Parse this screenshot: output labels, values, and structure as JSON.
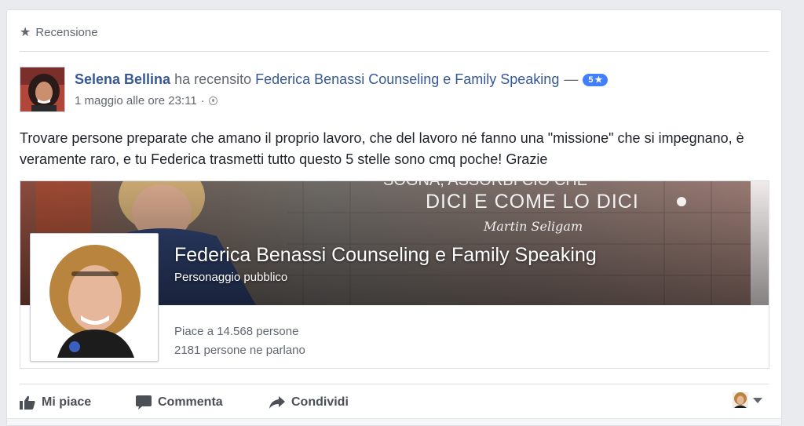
{
  "header": {
    "label": "Recensione",
    "icon": "star-icon"
  },
  "post": {
    "author": "Selena Bellina",
    "verb": "ha recensito",
    "page": "Federica Benassi Counseling e Family Speaking",
    "dash": "—",
    "rating": "5",
    "rating_star": "★",
    "timestamp": "1 maggio alle ore 23:11",
    "separator": "·",
    "text": "Trovare persone preparate che amano il proprio lavoro, che del lavoro né fanno una \"missione\" che si impegnano, è veramente raro, e tu Federica trasmetti tutto questo 5 stelle sono cmq poche! Grazie"
  },
  "attachment": {
    "cover_quote_top": "SOGNA, ASSORBI CIÒ CHE",
    "cover_quote": "DICI E COME LO DICI",
    "cover_signature": "Martin Seligam",
    "page_name": "Federica Benassi Counseling e Family Speaking",
    "category": "Personaggio pubblico",
    "likes": "Piace a 14.568 persone",
    "talking": "2181 persone ne parlano"
  },
  "actions": {
    "like": "Mi piace",
    "comment": "Commenta",
    "share": "Condividi"
  },
  "colors": {
    "link": "#365899",
    "muted": "#606770",
    "badge": "#4080ff"
  }
}
